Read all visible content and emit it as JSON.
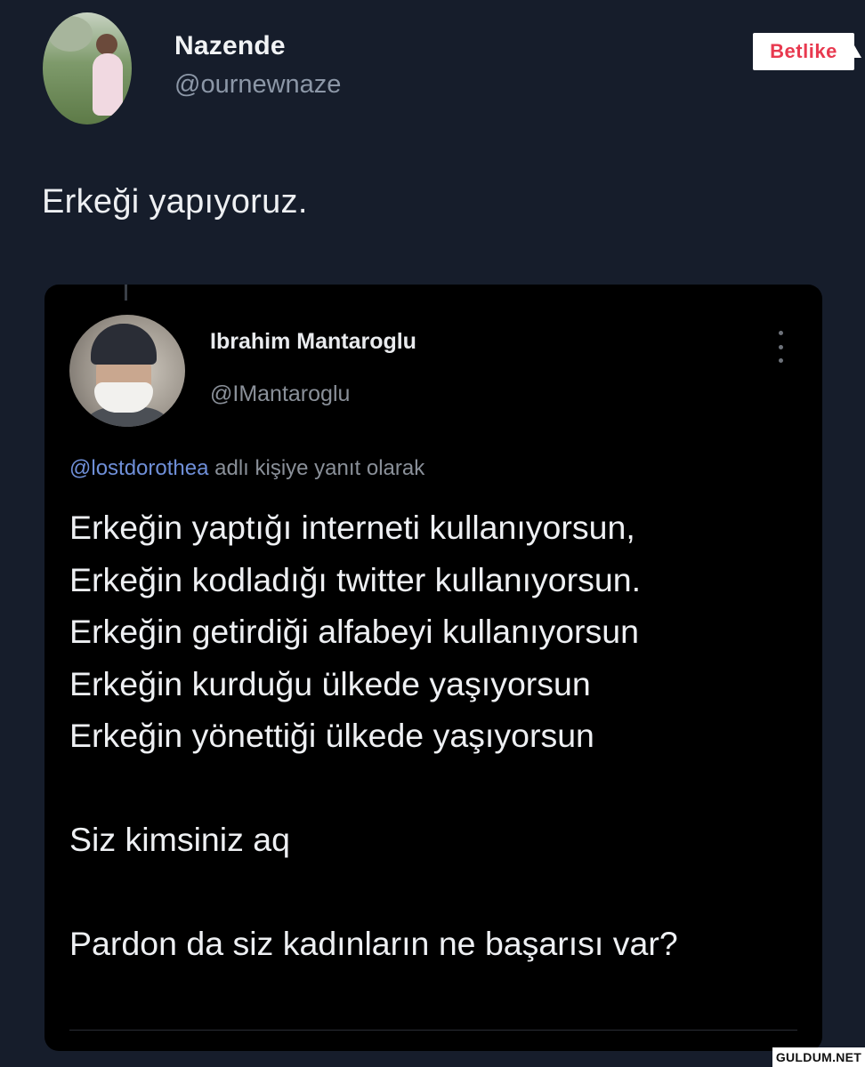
{
  "outer_tweet": {
    "display_name": "Nazende",
    "handle": "@ournewnaze",
    "text": "Erkeği yapıyoruz."
  },
  "badge": {
    "label": "Betlike"
  },
  "quoted_tweet": {
    "display_name": "Ibrahim Mantaroglu",
    "handle": "@IMantaroglu",
    "reply_mention": "@lostdorothea",
    "reply_suffix": " adlı kişiye yanıt olarak",
    "lines": [
      "Erkeğin yaptığı interneti kullanıyorsun,",
      "Erkeğin kodladığı twitter kullanıyorsun.",
      "Erkeğin getirdiği alfabeyi kullanıyorsun",
      "Erkeğin kurduğu ülkede yaşıyorsun",
      "Erkeğin yönettiği ülkede yaşıyorsun",
      "",
      "Siz kimsiniz aq",
      "",
      "Pardon da siz kadınların ne başarısı var?"
    ]
  },
  "watermark": {
    "label": "GULDUM.NET"
  },
  "colors": {
    "page_background": "#161d2b",
    "card_background": "#000000",
    "mention_color": "#6f8fd8",
    "badge_text": "#e8394f"
  }
}
